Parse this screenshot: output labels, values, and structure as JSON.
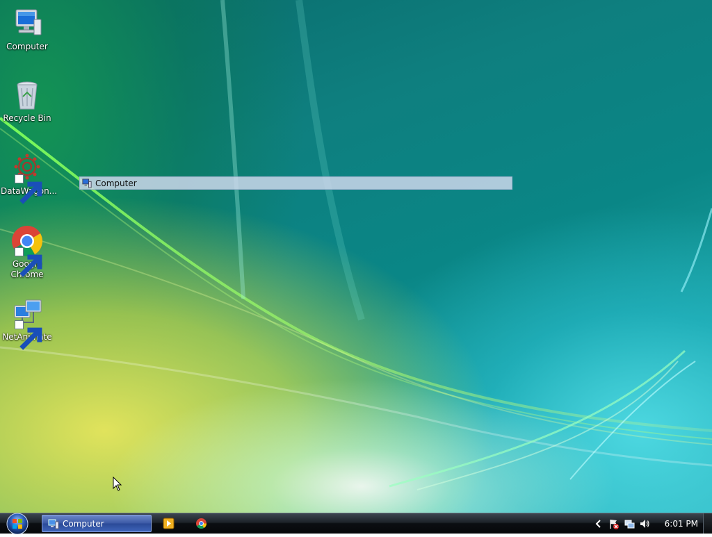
{
  "desktop": {
    "icons": [
      {
        "label": "Computer",
        "icon": "computer-icon"
      },
      {
        "label": "Recycle Bin",
        "icon": "recycle-bin-icon"
      },
      {
        "label": "DataWagon...",
        "icon": "datawagon-icon"
      },
      {
        "label": "Google Chrome",
        "icon": "chrome-icon"
      },
      {
        "label": "NetAnimate",
        "icon": "network-computers-icon"
      }
    ],
    "drag_preview": {
      "label": "Computer",
      "icon": "computer-icon"
    }
  },
  "taskbar": {
    "start_icon": "windows-orb-icon",
    "task_button": {
      "label": "Computer",
      "icon": "computer-icon"
    },
    "quick_launch": [
      {
        "icon": "media-player-icon"
      },
      {
        "icon": "chrome-icon"
      }
    ],
    "tray": {
      "icons": [
        "chevron-left-icon",
        "action-center-flag-icon",
        "network-icon",
        "volume-icon"
      ],
      "clock": "6:01 PM"
    }
  },
  "colors": {
    "taskbar": "#1c2228",
    "task_button": "#3c5aa6",
    "drag_preview": "#cdd7eb"
  }
}
